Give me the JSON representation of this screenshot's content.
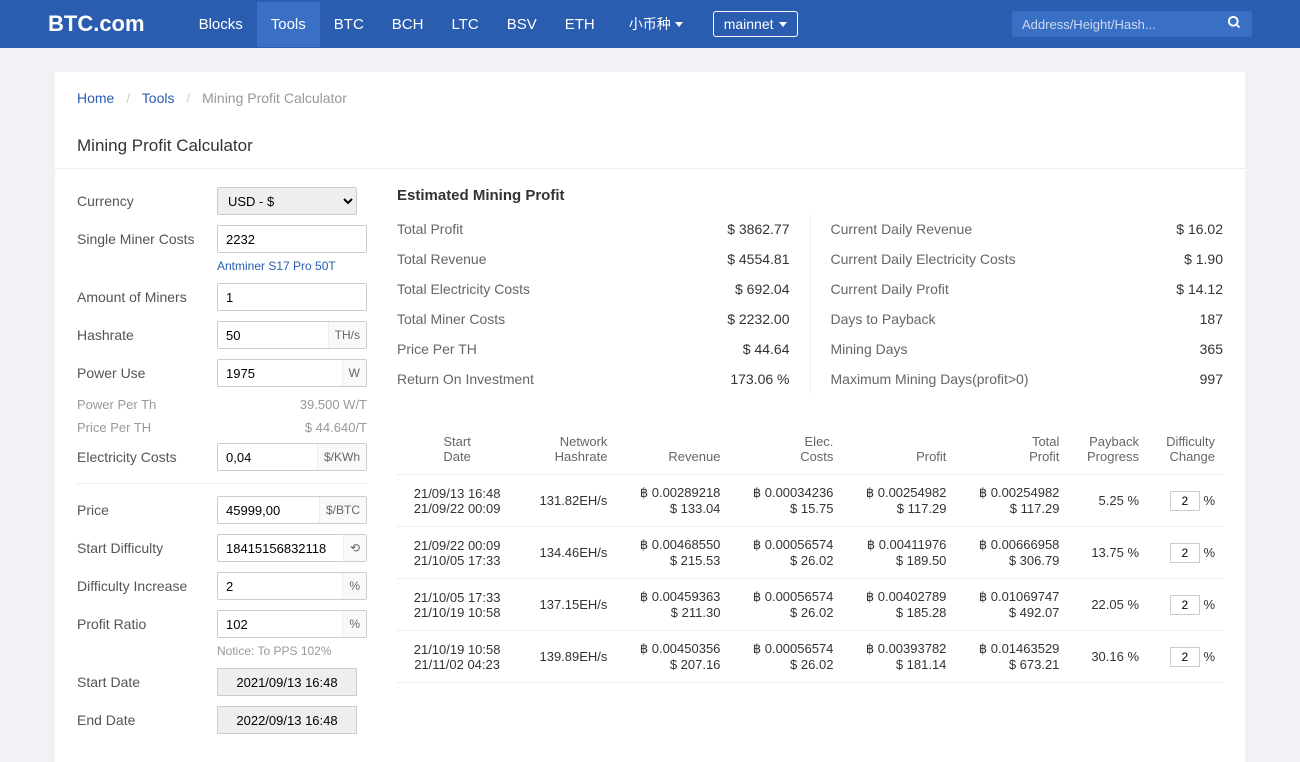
{
  "header": {
    "logo": "BTC.com",
    "nav": [
      "Blocks",
      "Tools",
      "BTC",
      "BCH",
      "LTC",
      "BSV",
      "ETH"
    ],
    "active_nav": "Tools",
    "altcoin": "小币种",
    "network": "mainnet",
    "search_placeholder": "Address/Height/Hash..."
  },
  "breadcrumb": {
    "home": "Home",
    "tools": "Tools",
    "current": "Mining Profit Calculator"
  },
  "page_title": "Mining Profit Calculator",
  "form": {
    "currency_label": "Currency",
    "currency_value": "USD - $",
    "single_miner_label": "Single Miner Costs",
    "single_miner_value": "2232",
    "miner_model": "Antminer S17 Pro 50T",
    "amount_label": "Amount of Miners",
    "amount_value": "1",
    "hashrate_label": "Hashrate",
    "hashrate_value": "50",
    "hashrate_unit": "TH/s",
    "power_label": "Power Use",
    "power_value": "1975",
    "power_unit": "W",
    "power_per_th_label": "Power Per Th",
    "power_per_th_value": "39.500 W/T",
    "price_per_th_label": "Price Per TH",
    "price_per_th_value": "$ 44.640/T",
    "elec_label": "Electricity Costs",
    "elec_value": "0,04",
    "elec_unit": "$/KWh",
    "price_label": "Price",
    "price_value": "45999,00",
    "price_unit": "$/BTC",
    "start_diff_label": "Start Difficulty",
    "start_diff_value": "18415156832118",
    "diff_inc_label": "Difficulty Increase",
    "diff_inc_value": "2",
    "diff_inc_unit": "%",
    "profit_ratio_label": "Profit Ratio",
    "profit_ratio_value": "102",
    "profit_ratio_unit": "%",
    "notice": "Notice: To PPS 102%",
    "start_date_label": "Start Date",
    "start_date_value": "2021/09/13 16:48",
    "end_date_label": "End Date",
    "end_date_value": "2022/09/13 16:48"
  },
  "estimate": {
    "title": "Estimated Mining Profit",
    "left": [
      {
        "label": "Total Profit",
        "value": "$ 3862.77"
      },
      {
        "label": "Total Revenue",
        "value": "$ 4554.81"
      },
      {
        "label": "Total Electricity Costs",
        "value": "$ 692.04"
      },
      {
        "label": "Total Miner Costs",
        "value": "$ 2232.00"
      },
      {
        "label": "Price Per TH",
        "value": "$ 44.64"
      },
      {
        "label": "Return On Investment",
        "value": "173.06 %"
      }
    ],
    "right": [
      {
        "label": "Current Daily Revenue",
        "value": "$ 16.02"
      },
      {
        "label": "Current Daily Electricity Costs",
        "value": "$ 1.90"
      },
      {
        "label": "Current Daily Profit",
        "value": "$ 14.12"
      },
      {
        "label": "Days to Payback",
        "value": "187"
      },
      {
        "label": "Mining Days",
        "value": "365"
      },
      {
        "label": "Maximum Mining Days(profit>0)",
        "value": "997"
      }
    ]
  },
  "table": {
    "headers": [
      "Start Date",
      "Network Hashrate",
      "Revenue",
      "Elec. Costs",
      "Profit",
      "Total Profit",
      "Payback Progress",
      "Difficulty Change"
    ],
    "rows": [
      {
        "date1": "21/09/13 16:48",
        "date2": "21/09/22 00:09",
        "hash": "131.82EH/s",
        "rev_btc": "฿ 0.00289218",
        "rev_usd": "$ 133.04",
        "elec_btc": "฿ 0.00034236",
        "elec_usd": "$ 15.75",
        "prof_btc": "฿ 0.00254982",
        "prof_usd": "$ 117.29",
        "tot_btc": "฿ 0.00254982",
        "tot_usd": "$ 117.29",
        "payback": "5.25 %",
        "diff": "2"
      },
      {
        "date1": "21/09/22 00:09",
        "date2": "21/10/05 17:33",
        "hash": "134.46EH/s",
        "rev_btc": "฿ 0.00468550",
        "rev_usd": "$ 215.53",
        "elec_btc": "฿ 0.00056574",
        "elec_usd": "$ 26.02",
        "prof_btc": "฿ 0.00411976",
        "prof_usd": "$ 189.50",
        "tot_btc": "฿ 0.00666958",
        "tot_usd": "$ 306.79",
        "payback": "13.75 %",
        "diff": "2"
      },
      {
        "date1": "21/10/05 17:33",
        "date2": "21/10/19 10:58",
        "hash": "137.15EH/s",
        "rev_btc": "฿ 0.00459363",
        "rev_usd": "$ 211.30",
        "elec_btc": "฿ 0.00056574",
        "elec_usd": "$ 26.02",
        "prof_btc": "฿ 0.00402789",
        "prof_usd": "$ 185.28",
        "tot_btc": "฿ 0.01069747",
        "tot_usd": "$ 492.07",
        "payback": "22.05 %",
        "diff": "2"
      },
      {
        "date1": "21/10/19 10:58",
        "date2": "21/11/02 04:23",
        "hash": "139.89EH/s",
        "rev_btc": "฿ 0.00450356",
        "rev_usd": "$ 207.16",
        "elec_btc": "฿ 0.00056574",
        "elec_usd": "$ 26.02",
        "prof_btc": "฿ 0.00393782",
        "prof_usd": "$ 181.14",
        "tot_btc": "฿ 0.01463529",
        "tot_usd": "$ 673.21",
        "payback": "30.16 %",
        "diff": "2"
      }
    ]
  }
}
